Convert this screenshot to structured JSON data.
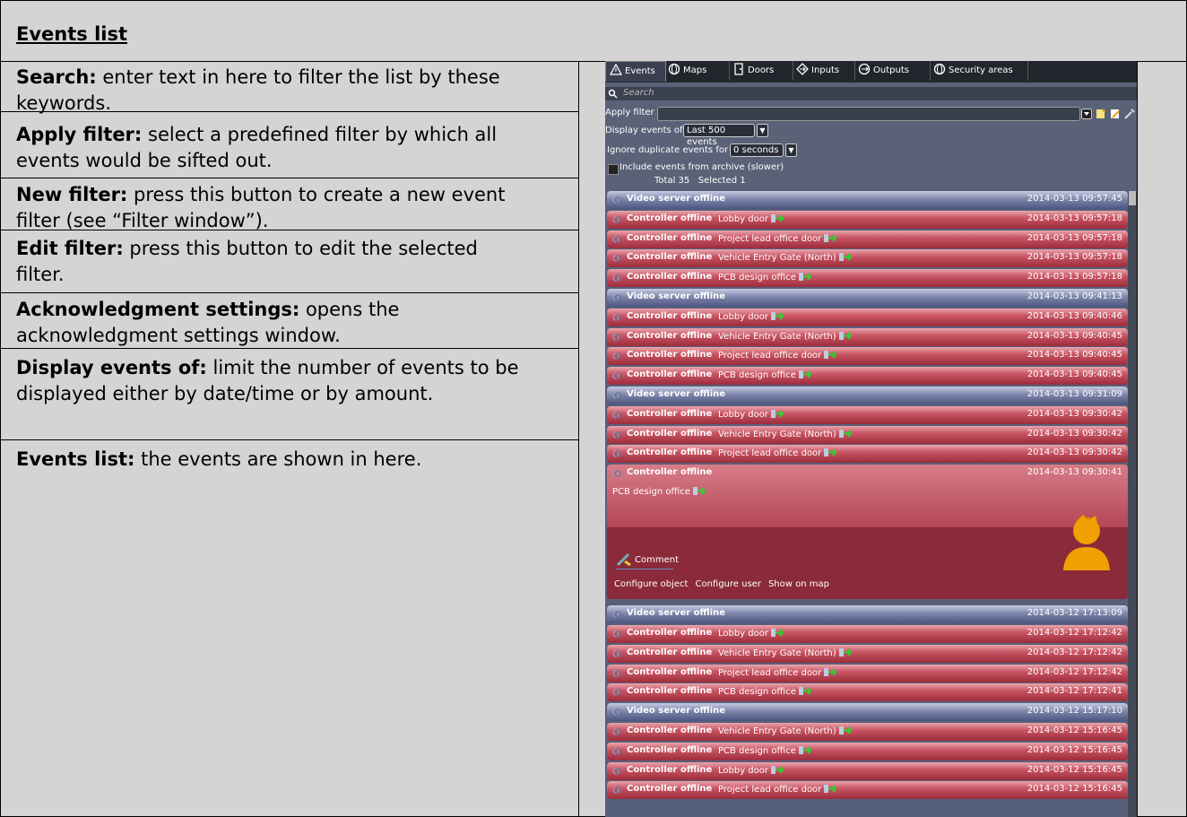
{
  "heading": "Events list",
  "descriptions": [
    {
      "term": "Search:",
      "text": " enter text in here to filter the list by these keywords."
    },
    {
      "term": "Apply filter:",
      "text": " select a predefined filter by which all events would be sifted out."
    },
    {
      "term": "New filter:",
      "text": " press this button to create a new event filter (see “Filter window”)."
    },
    {
      "term": "Edit filter:",
      "text": " press this button to edit the selected filter."
    },
    {
      "term": "Acknowledgment settings:",
      "text": " opens the acknowledgment settings window."
    },
    {
      "term": "Display events of:",
      "text": " limit the number of events to be displayed either by date/time or by amount."
    },
    {
      "term": "Events list:",
      "text": " the events are shown in here."
    }
  ],
  "app": {
    "tabs": [
      {
        "label": "Events",
        "icon": "warning-icon",
        "active": true
      },
      {
        "label": "Maps",
        "icon": "globe-icon"
      },
      {
        "label": "Doors",
        "icon": "door-icon"
      },
      {
        "label": "Inputs",
        "icon": "input-icon"
      },
      {
        "label": "Outputs",
        "icon": "output-icon"
      },
      {
        "label": "Security areas",
        "icon": "globe-icon"
      }
    ],
    "search_placeholder": "Search",
    "apply_filter_label": "Apply filter",
    "display_events_label": "Display events of:",
    "display_events_value": "Last 500 events",
    "ignore_duplicates_label": "Ignore duplicate events for",
    "ignore_duplicates_value": "0 seconds",
    "include_archive_label": "Include events from archive (slower)",
    "summary": "Total 35   Selected 1",
    "events_before": [
      {
        "type": "blue",
        "event": "Video server offline",
        "location": "",
        "time": "2014-03-13 09:57:45"
      },
      {
        "type": "red",
        "event": "Controller offline",
        "location": "Lobby door",
        "time": "2014-03-13 09:57:18"
      },
      {
        "type": "red",
        "event": "Controller offline",
        "location": "Project lead office door",
        "time": "2014-03-13 09:57:18"
      },
      {
        "type": "red",
        "event": "Controller offline",
        "location": "Vehicle Entry Gate (North)",
        "time": "2014-03-13 09:57:18"
      },
      {
        "type": "red",
        "event": "Controller offline",
        "location": "PCB design office",
        "time": "2014-03-13 09:57:18"
      },
      {
        "type": "blue",
        "event": "Video server offline",
        "location": "",
        "time": "2014-03-13 09:41:13"
      },
      {
        "type": "red",
        "event": "Controller offline",
        "location": "Lobby door",
        "time": "2014-03-13 09:40:46"
      },
      {
        "type": "red",
        "event": "Controller offline",
        "location": "Vehicle Entry Gate (North)",
        "time": "2014-03-13 09:40:45"
      },
      {
        "type": "red",
        "event": "Controller offline",
        "location": "Project lead office door",
        "time": "2014-03-13 09:40:45"
      },
      {
        "type": "red",
        "event": "Controller offline",
        "location": "PCB design office",
        "time": "2014-03-13 09:40:45"
      },
      {
        "type": "blue",
        "event": "Video server offline",
        "location": "",
        "time": "2014-03-13 09:31:09"
      },
      {
        "type": "red",
        "event": "Controller offline",
        "location": "Lobby door",
        "time": "2014-03-13 09:30:42"
      },
      {
        "type": "red",
        "event": "Controller offline",
        "location": "Vehicle Entry Gate (North)",
        "time": "2014-03-13 09:30:42"
      },
      {
        "type": "red",
        "event": "Controller offline",
        "location": "Project lead office door",
        "time": "2014-03-13 09:30:42"
      }
    ],
    "expanded_event": {
      "event": "Controller offline",
      "time": "2014-03-13 09:30:41",
      "location": "PCB design office",
      "comment_label": "Comment",
      "links": [
        "Configure object",
        "Configure user",
        "Show on map"
      ]
    },
    "events_after": [
      {
        "type": "blue",
        "event": "Video server offline",
        "location": "",
        "time": "2014-03-12 17:13:09"
      },
      {
        "type": "red",
        "event": "Controller offline",
        "location": "Lobby door",
        "time": "2014-03-12 17:12:42"
      },
      {
        "type": "red",
        "event": "Controller offline",
        "location": "Vehicle Entry Gate (North)",
        "time": "2014-03-12 17:12:42"
      },
      {
        "type": "red",
        "event": "Controller offline",
        "location": "Project lead office door",
        "time": "2014-03-12 17:12:42"
      },
      {
        "type": "red",
        "event": "Controller offline",
        "location": "PCB design office",
        "time": "2014-03-12 17:12:41"
      },
      {
        "type": "blue",
        "event": "Video server offline",
        "location": "",
        "time": "2014-03-12 15:17:10"
      },
      {
        "type": "red",
        "event": "Controller offline",
        "location": "Vehicle Entry Gate (North)",
        "time": "2014-03-12 15:16:45"
      },
      {
        "type": "red",
        "event": "Controller offline",
        "location": "PCB design office",
        "time": "2014-03-12 15:16:45"
      },
      {
        "type": "red",
        "event": "Controller offline",
        "location": "Lobby door",
        "time": "2014-03-12 15:16:45"
      },
      {
        "type": "red",
        "event": "Controller offline",
        "location": "Project lead office door",
        "time": "2014-03-12 15:16:45"
      }
    ],
    "colors": {
      "event_red": "#c95563",
      "event_blue": "#7d86aa",
      "panel": "#56607a"
    }
  }
}
